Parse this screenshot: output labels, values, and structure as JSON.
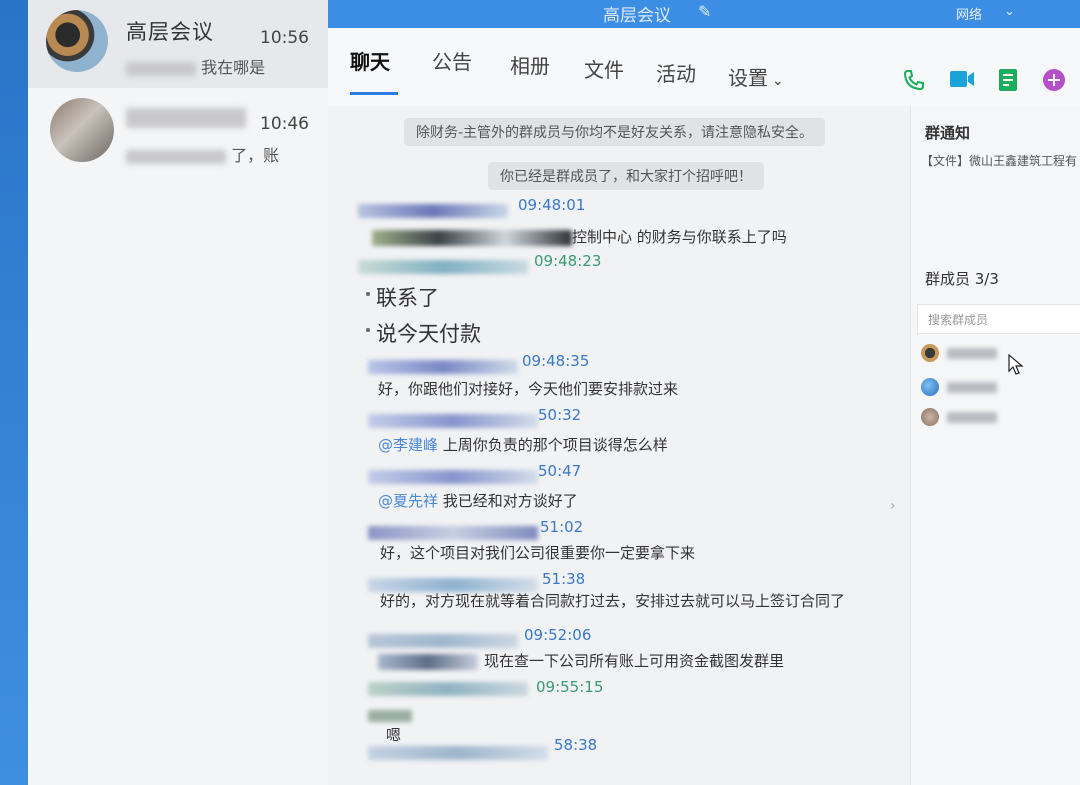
{
  "sidebar": {
    "conversations": [
      {
        "name": "高层会议",
        "time": "10:56",
        "preview": "我在哪是"
      },
      {
        "name": "",
        "time": "10:46",
        "preview": "了，账"
      }
    ]
  },
  "window": {
    "title": "高层会议",
    "edit_icon": "✎",
    "restore_label": "网络",
    "collapse_icon": "⌄"
  },
  "tabs": [
    {
      "label": "聊天"
    },
    {
      "label": "公告"
    },
    {
      "label": "相册"
    },
    {
      "label": "文件"
    },
    {
      "label": "活动"
    },
    {
      "label": "设置"
    }
  ],
  "actions": [
    {
      "icon": "phone-icon",
      "color": "#1aad5b"
    },
    {
      "icon": "video-icon",
      "color": "#1aa3d8"
    },
    {
      "icon": "doc-icon",
      "color": "#1aad5b"
    },
    {
      "icon": "plus-icon",
      "color": "#b450c8"
    }
  ],
  "chat": {
    "system_notice_1": "除财务-主管外的群成员与你均不是好友关系，请注意隐私安全。",
    "system_notice_2": "你已经是群成员了，和大家打个招呼吧！",
    "messages": [
      {
        "time": "09:48:01",
        "text": "控制中心 的财务与你联系上了吗"
      },
      {
        "time": "09:48:23",
        "lines": [
          "联系了",
          "说今天付款"
        ]
      },
      {
        "time": "09:48:35",
        "text": "好，你跟他们对接好，今天他们要安排款过来"
      },
      {
        "time": "50:32",
        "mention": "@李建峰",
        "text": "上周你负责的那个项目谈得怎么样"
      },
      {
        "time": "50:47",
        "mention": "@夏先祥",
        "text": "我已经和对方谈好了"
      },
      {
        "time": "51:02",
        "text": "好，这个项目对我们公司很重要你一定要拿下来"
      },
      {
        "time": "51:38",
        "text": "好的，对方现在就等着合同款打过去，安排过去就可以马上签订合同了"
      },
      {
        "time": "09:52:06",
        "text": "现在查一下公司所有账上可用资金截图发群里"
      },
      {
        "time": "09:55:15",
        "text": "嗯"
      },
      {
        "time": "58:38",
        "text": ""
      }
    ]
  },
  "panel": {
    "notice_title": "群通知",
    "notice_text": "【文件】微山王鑫建筑工程有",
    "members_title": "群成员 3/3",
    "search_placeholder": "搜索群成员"
  }
}
